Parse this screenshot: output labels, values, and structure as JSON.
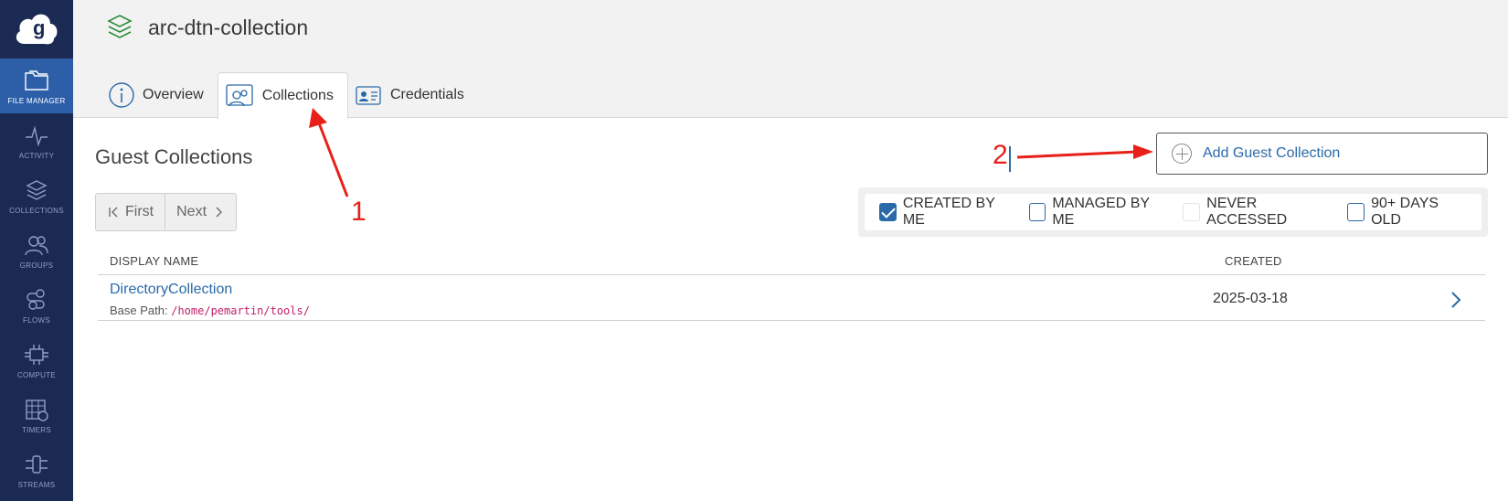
{
  "sidebar": {
    "items": [
      {
        "label": "FILE MANAGER",
        "icon": "folder-icon",
        "active": true
      },
      {
        "label": "ACTIVITY",
        "icon": "activity-icon"
      },
      {
        "label": "COLLECTIONS",
        "icon": "layers-icon"
      },
      {
        "label": "GROUPS",
        "icon": "users-icon"
      },
      {
        "label": "FLOWS",
        "icon": "flows-icon"
      },
      {
        "label": "COMPUTE",
        "icon": "chip-icon"
      },
      {
        "label": "TIMERS",
        "icon": "calendar-clock-icon"
      },
      {
        "label": "STREAMS",
        "icon": "stream-icon"
      }
    ]
  },
  "header": {
    "title": "arc-dtn-collection",
    "tabs": [
      {
        "label": "Overview",
        "icon": "info-icon"
      },
      {
        "label": "Collections",
        "icon": "collections-icon",
        "active": true
      },
      {
        "label": "Credentials",
        "icon": "id-card-icon"
      }
    ]
  },
  "main": {
    "section_title": "Guest Collections",
    "pager": {
      "first": "First",
      "next": "Next"
    },
    "add_button": "Add Guest Collection",
    "filters": [
      {
        "label": "CREATED BY ME",
        "checked": true
      },
      {
        "label": "MANAGED BY ME",
        "checked": false
      },
      {
        "label": "NEVER ACCESSED",
        "checked": false
      },
      {
        "label": "90+ DAYS OLD",
        "checked": false
      }
    ],
    "table": {
      "columns": [
        "DISPLAY NAME",
        "CREATED"
      ],
      "rows": [
        {
          "name": "DirectoryCollection",
          "base_path_label": "Base Path:",
          "base_path": "/home/pemartin/tools/",
          "created": "2025-03-18"
        }
      ]
    }
  },
  "annotations": {
    "one": "1",
    "two": "2"
  },
  "colors": {
    "sidebar": "#1b2a52",
    "active": "#2d5fa8",
    "link": "#2a6aa8",
    "annotation": "#e8201a"
  }
}
